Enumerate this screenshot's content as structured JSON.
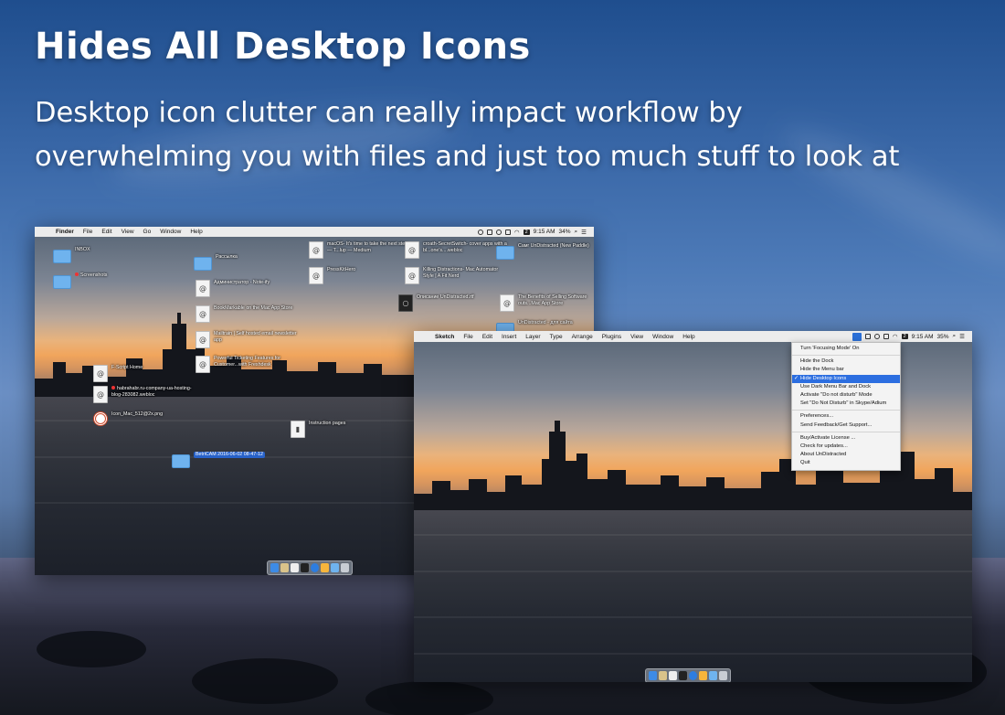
{
  "headline": "Hides All Desktop Icons",
  "subline_1": "Desktop icon clutter can really impact workflow by",
  "subline_2": "overwhelming you with files and just too much stuff to look at",
  "left_screen": {
    "menubar": {
      "app": "Finder",
      "menus": [
        "File",
        "Edit",
        "View",
        "Go",
        "Window",
        "Help"
      ],
      "status_badge": "2",
      "time": "9:15 AM",
      "battery": "34%"
    },
    "icons": [
      {
        "label": "INBOX",
        "glyph": "folder"
      },
      {
        "label": "Screenshots",
        "glyph": "folder",
        "tag": "red"
      },
      {
        "label": "Рассылка",
        "glyph": "folder"
      },
      {
        "label": "Администратор - Note-ify",
        "glyph": "doc"
      },
      {
        "label": "BookMarkable on the Mac App Store",
        "glyph": "doc"
      },
      {
        "label": "Mailtrain | Self hosted email newsletter app",
        "glyph": "doc"
      },
      {
        "label": "Powerful Ticketing Features for Customer...with Freshdesk",
        "glyph": "doc"
      },
      {
        "label": "macOS- It's time to take the next step. — T...lup — Medium",
        "glyph": "doc"
      },
      {
        "label": "PressKitHero",
        "glyph": "doc"
      },
      {
        "label": "croath-SecretSwitch- cover apps with a bl...one's....webloc",
        "glyph": "doc"
      },
      {
        "label": "Killing Distractions- Mac Automator Style | A Fit Nerd",
        "glyph": "doc"
      },
      {
        "label": "Описание UnDistracted.rtf",
        "glyph": "dark"
      },
      {
        "label": "Cамr UnDistracted (New Paddle)",
        "glyph": "folder"
      },
      {
        "label": "The Benefits of Selling Software outs...Mac App Store",
        "glyph": "doc"
      },
      {
        "label": "UnDistracted - для сайта",
        "glyph": "folder"
      },
      {
        "label": "F-Script Home",
        "glyph": "doc"
      },
      {
        "label": "habrahabr.ru-company-ua-hosting-blog-283082.webloc",
        "glyph": "doc",
        "tag": "red"
      },
      {
        "label": "Icon_Mac_512@2x.png",
        "glyph": "target"
      },
      {
        "label": "BetriCAM 2016-06-02 08-47-12",
        "glyph": "folder",
        "selected": true
      },
      {
        "label": "Instruction pages",
        "glyph": "doc"
      }
    ]
  },
  "right_screen": {
    "menubar": {
      "app": "Sketch",
      "menus": [
        "File",
        "Edit",
        "Insert",
        "Layer",
        "Type",
        "Arrange",
        "Plugins",
        "View",
        "Window",
        "Help"
      ],
      "status_badge": "2",
      "time": "9:15 AM",
      "battery": "35%"
    },
    "dropdown": {
      "groups": [
        [
          {
            "label": "Turn 'Focusing Mode' On"
          }
        ],
        [
          {
            "label": "Hide the Dock"
          },
          {
            "label": "Hide the Menu bar"
          },
          {
            "label": "Hide Desktop Icons",
            "checked": true,
            "highlighted": true
          },
          {
            "label": "Use Dark Menu Bar and Dock"
          },
          {
            "label": "Activate \"Do not disturb\" Mode"
          },
          {
            "label": "Set \"Do Not Disturb\" in Skype/Adium"
          }
        ],
        [
          {
            "label": "Preferences..."
          },
          {
            "label": "Send Feedback/Get Support..."
          }
        ],
        [
          {
            "label": "Buy/Activate License ..."
          },
          {
            "label": "Check for updates..."
          },
          {
            "label": "About UnDistracted"
          },
          {
            "label": "Quit"
          }
        ]
      ],
      "check_glyph": "✓"
    }
  },
  "colors": {
    "highlight": "#2c6ee0",
    "folder": "#6fb3ee",
    "sunset": "#f1a55c"
  },
  "icons": {
    "apple": "apple-icon",
    "wifi": "wifi-icon",
    "search": "search-icon",
    "list": "list-icon"
  }
}
